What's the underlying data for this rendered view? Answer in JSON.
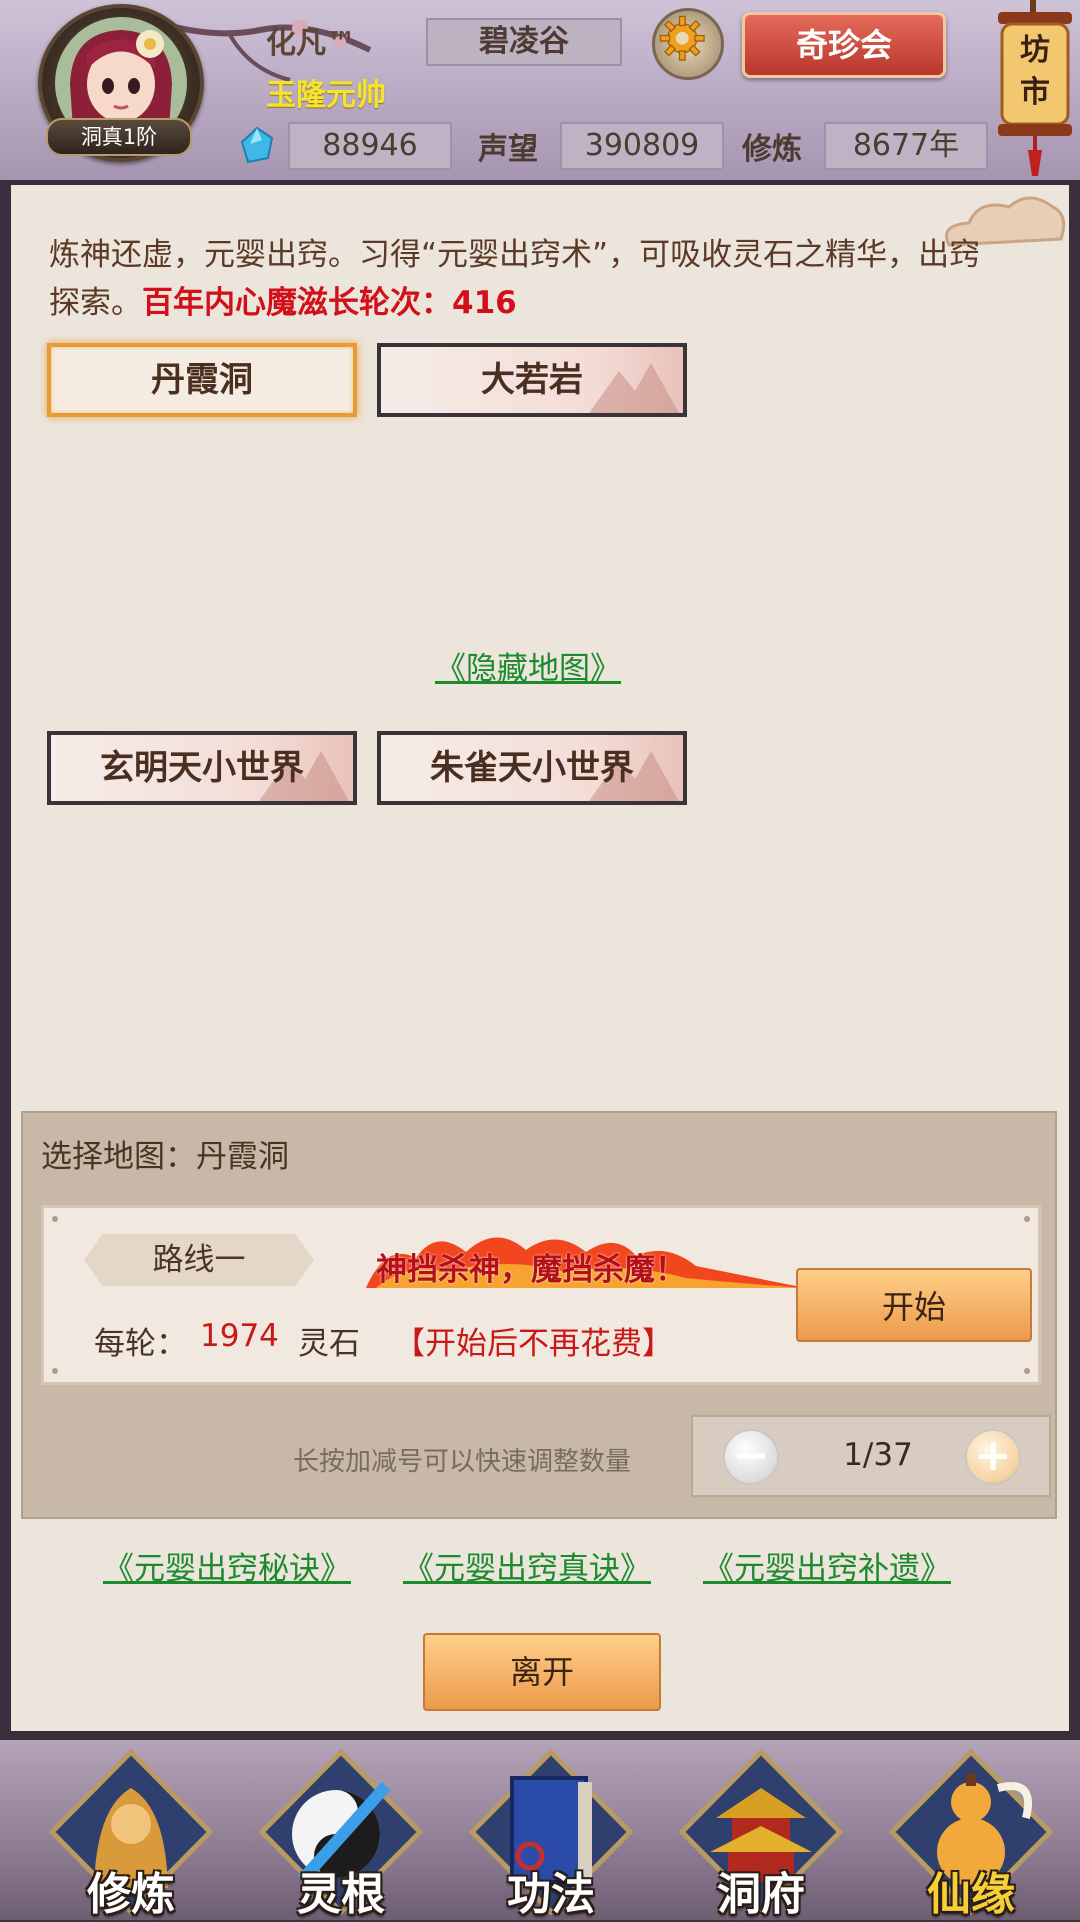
{
  "header": {
    "player_name": "化凡™",
    "player_title": "玉隆元帅",
    "rank": "洞真1阶",
    "location": "碧凌谷",
    "shop_label": "奇珍会",
    "market_label": "坊市",
    "spirit_stones": "88946",
    "reputation_label": "声望",
    "reputation": "390809",
    "cultivation_label": "修炼",
    "cultivation": "8677年"
  },
  "panel": {
    "intro_text": "炼神还虚，元婴出窍。习得“元婴出窍术”，可吸收灵石之精华，出窍探索。",
    "intro_highlight": "百年内心魔滋长轮次：416",
    "maps": [
      "丹霞洞",
      "大若岩"
    ],
    "hidden_map_link": "《隐藏地图》",
    "hidden_maps": [
      "玄明天小世界",
      "朱雀天小世界"
    ],
    "select_label": "选择地图：丹霞洞",
    "route_name": "路线一",
    "slogan": "神挡杀神，魔挡杀魔！",
    "start_label": "开始",
    "cost_label": "每轮：",
    "cost_value": "1974",
    "cost_unit": "灵石",
    "cost_note": "【开始后不再花费】",
    "hint": "长按加减号可以快速调整数量",
    "quantity": "1/37",
    "guide_links": [
      "《元婴出窍秘诀》",
      "《元婴出窍真诀》",
      "《元婴出窍补遗》"
    ],
    "leave_label": "离开"
  },
  "nav": [
    {
      "label": "修炼",
      "icon": "monk-icon"
    },
    {
      "label": "灵根",
      "icon": "yin-yang-sword-icon"
    },
    {
      "label": "功法",
      "icon": "book-icon"
    },
    {
      "label": "洞府",
      "icon": "pagoda-icon"
    },
    {
      "label": "仙缘",
      "icon": "gourd-icon"
    }
  ],
  "colors": {
    "accent_red": "#d2101a",
    "link_green": "#1e8a2e",
    "button_orange": "#ec9a4a",
    "title_yellow": "#f5e52a"
  }
}
